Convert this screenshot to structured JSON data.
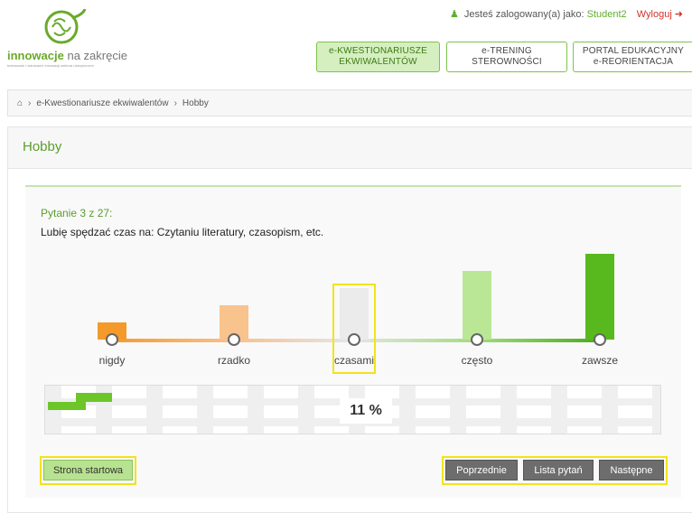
{
  "brand": {
    "name_bold": "innowacje",
    "name_rest": " na zakręcie",
    "tagline": "testowanie i wdrażanie innowacji sektora ubezpieczeń"
  },
  "userbar": {
    "prefix": "Jesteś zalogowany(a) jako:",
    "username": "Student2",
    "logout": "Wyloguj"
  },
  "nav": {
    "tabs": [
      {
        "line1": "e-KWESTIONARIUSZE",
        "line2": "EKWIWALENTÓW",
        "active": true
      },
      {
        "line1": "e-TRENING",
        "line2": "STEROWNOŚCI",
        "active": false
      },
      {
        "line1": "PORTAL EDUKACYJNY",
        "line2": "e-REORIENTACJA",
        "active": false
      }
    ]
  },
  "breadcrumb": {
    "items": [
      "e-Kwestionariusze ekwiwalentów",
      "Hobby"
    ]
  },
  "page": {
    "title": "Hobby"
  },
  "question": {
    "counter": "Pytanie 3 z 27:",
    "text": "Lubię spędzać czas na: Czytaniu literatury, czasopism, etc."
  },
  "scale": {
    "options": [
      {
        "label": "nigdy",
        "color": "#f39a2b",
        "level": 1
      },
      {
        "label": "rzadko",
        "color": "#f8c38c",
        "level": 2
      },
      {
        "label": "czasami",
        "color": "#ebebeb",
        "level": 3
      },
      {
        "label": "często",
        "color": "#b9e796",
        "level": 4
      },
      {
        "label": "zawsze",
        "color": "#58b91f",
        "level": 5
      }
    ],
    "highlighted": "czasami"
  },
  "progress": {
    "percent_text": "11 %",
    "value": 0.11
  },
  "buttons": {
    "start": "Strona startowa",
    "prev": "Poprzednie",
    "list": "Lista pytań",
    "next": "Następne"
  },
  "colors": {
    "brand_green": "#5fae2d",
    "highlight_yellow": "#f2e31a",
    "logout_red": "#d2322d"
  }
}
